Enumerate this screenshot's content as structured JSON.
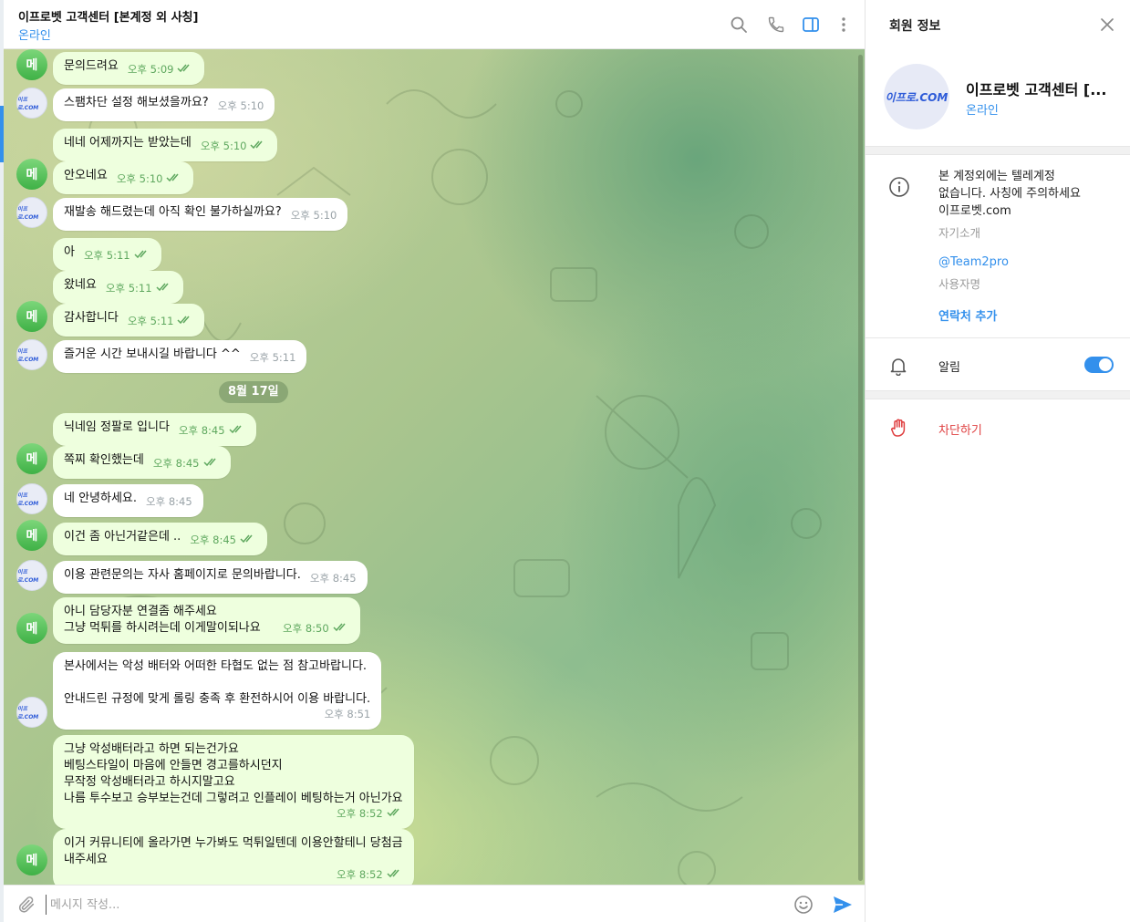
{
  "chat": {
    "title": "이프로벳 고객센터 [본계정 외 사칭]",
    "status": "온라인"
  },
  "date_separator": "8월 17일",
  "avatars": {
    "me_initial": "메",
    "cs_logo": "이프로.COM"
  },
  "messages": [
    {
      "sender": "me",
      "text": "문의드려요",
      "time": "오후 5:09"
    },
    {
      "sender": "cs",
      "text": "스팸차단 설정 해보셨을까요?",
      "time": "오후 5:10"
    },
    {
      "sender": "me",
      "text": "네네 어제까지는 받았는데",
      "time": "오후 5:10"
    },
    {
      "sender": "me",
      "text": "안오네요",
      "time": "오후 5:10"
    },
    {
      "sender": "cs",
      "text": "재발송 해드렸는데 아직 확인 불가하실까요?",
      "time": "오후 5:10"
    },
    {
      "sender": "me",
      "text": "아",
      "time": "오후 5:11"
    },
    {
      "sender": "me",
      "text": "왔네요",
      "time": "오후 5:11"
    },
    {
      "sender": "me",
      "text": "감사합니다",
      "time": "오후 5:11"
    },
    {
      "sender": "cs",
      "text": "즐거운 시간 보내시길 바랍니다 ^^",
      "time": "오후 5:11"
    },
    {
      "sender": "me",
      "text": "닉네임 정팔로 입니다",
      "time": "오후 8:45"
    },
    {
      "sender": "me",
      "text": "쪽찌 확인했는데",
      "time": "오후 8:45"
    },
    {
      "sender": "cs",
      "text": "네 안녕하세요.",
      "time": "오후 8:45"
    },
    {
      "sender": "me",
      "text": "이건 좀 아닌거같은데 ..",
      "time": "오후 8:45"
    },
    {
      "sender": "cs",
      "text": "이용 관련문의는 자사 홈페이지로 문의바랍니다.",
      "time": "오후 8:45"
    },
    {
      "sender": "me",
      "text": "아니 담당자분 연결좀 해주세요\n그냥 먹튀를 하시려는데 이게말이되나요",
      "time": "오후 8:50"
    },
    {
      "sender": "cs",
      "text": "본사에서는 악성 배터와 어떠한 타협도 없는 점 참고바랍니다.\n\n안내드린 규정에 맞게 롤링 충족 후 환전하시어 이용 바랍니다.",
      "time": "오후 8:51"
    },
    {
      "sender": "me",
      "text": "그냥 악성배터라고 하면 되는건가요\n베팅스타일이 마음에 안들면 경고를하시던지\n무작정 악성배터라고 하시지말고요\n나름 투수보고 승부보는건데 그렇려고 인플레이 베팅하는거 아닌가요",
      "time": "오후 8:52"
    },
    {
      "sender": "me",
      "text": "이거 커뮤니티에 올라가면 누가봐도 먹튀일텐데 이용안할테니 당첨금\n내주세요",
      "time": "오후 8:52"
    }
  ],
  "composer": {
    "placeholder": "메시지 작성..."
  },
  "info_panel": {
    "title": "회원 정보",
    "name": "이프로벳 고객센터 [...",
    "status": "온라인",
    "avatar_text": "이프로.COM",
    "bio": "본 계정외에는 텔레계정\n없습니다. 사칭에 주의하세요\n이프로벳.com",
    "bio_label": "자기소개",
    "username": "@Team2pro",
    "username_label": "사용자명",
    "add_contact": "연락처 추가",
    "notifications_label": "알림",
    "notifications_on": true,
    "block_label": "차단하기"
  },
  "colors": {
    "accent": "#3390ec",
    "outgoing_bubble": "#eeffde",
    "incoming_bubble": "#ffffff",
    "danger": "#df3f40",
    "read_ticks": "#5fa85f"
  },
  "icons": {
    "header": [
      "search-icon",
      "phone-icon",
      "sidebar-toggle-icon",
      "more-vertical-icon"
    ],
    "composer": [
      "paperclip-icon",
      "emoji-icon",
      "send-icon"
    ],
    "info": [
      "close-icon",
      "info-icon",
      "bell-icon",
      "hand-stop-icon"
    ]
  }
}
